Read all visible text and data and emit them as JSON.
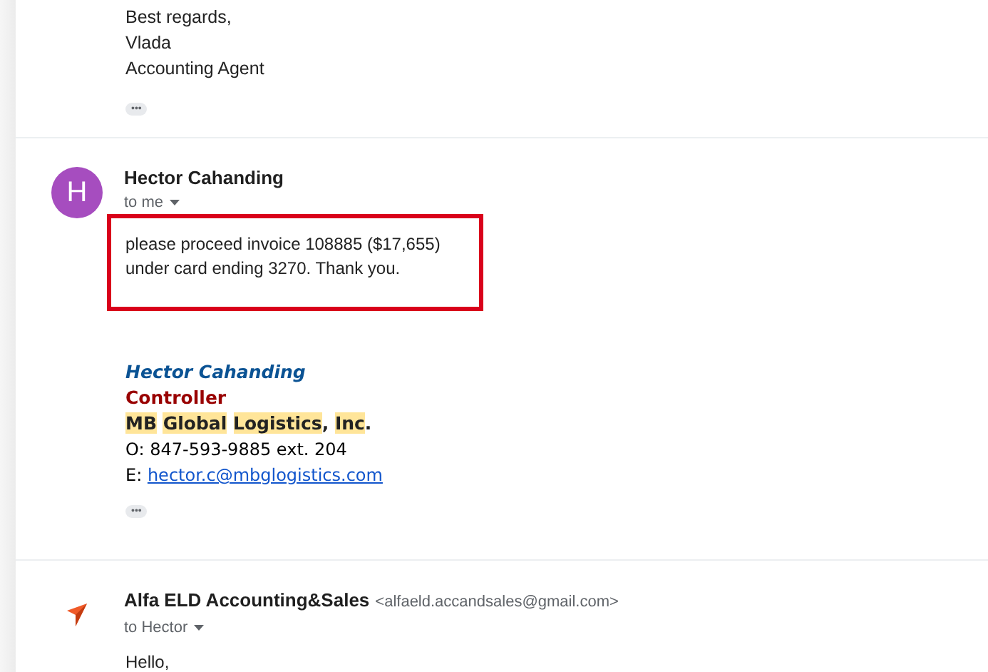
{
  "previous_message": {
    "closing_lines": [
      "Best regards,",
      "Vlada",
      "Accounting Agent"
    ],
    "trimmed_content_button": "•••"
  },
  "messages": [
    {
      "sender": "Hector Cahanding",
      "avatar": {
        "kind": "letter",
        "letter": "H"
      },
      "recipient": "to me",
      "body_lines": [
        "please proceed invoice 108885 ($17,655)",
        "under card ending 3270. Thank you."
      ],
      "body_highlighted": true,
      "signature": {
        "name": "Hector Cahanding",
        "title": "Controller",
        "company": [
          {
            "kind": "word",
            "text": "MB",
            "highlighted": true
          },
          {
            "kind": "word",
            "text": "Global",
            "highlighted": true
          },
          {
            "kind": "word",
            "text": "Logistics",
            "highlighted": true
          },
          {
            "kind": "punctuation",
            "text": ",",
            "highlighted": false
          },
          {
            "kind": "word",
            "text": "Inc",
            "highlighted": true
          },
          {
            "kind": "punctuation",
            "text": ".",
            "highlighted": false
          }
        ],
        "phone": "O: 847-593-9885 ext. 204",
        "email_label": "E: ",
        "email": "hector.c@mbglogistics.com"
      },
      "trimmed_content_button": "•••"
    },
    {
      "sender": "Alfa ELD Accounting&Sales",
      "sender_address": "<alfaeld.accandsales@gmail.com>",
      "avatar": {
        "kind": "logo"
      },
      "recipient": "to Hector",
      "body_lines": [
        "Hello,"
      ],
      "body_highlighted": false
    }
  ]
}
